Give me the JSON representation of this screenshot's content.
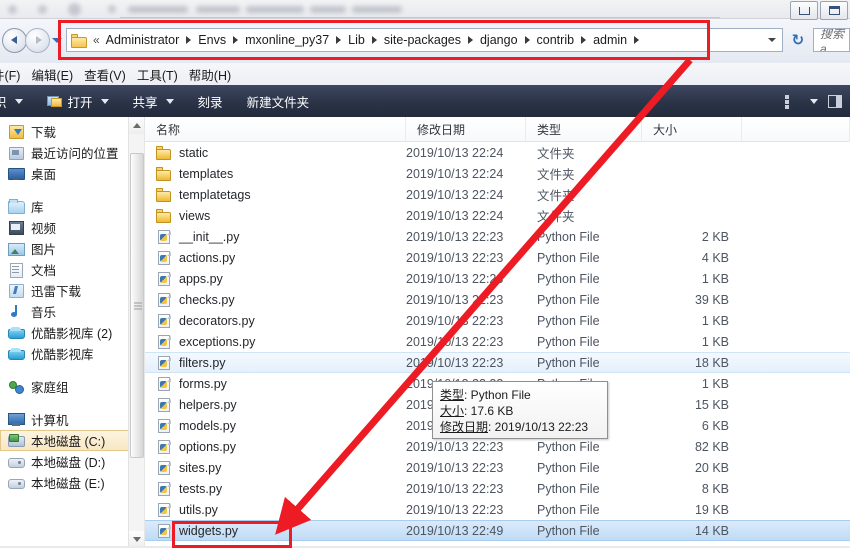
{
  "window": {
    "controls": [
      {
        "name": "minimize",
        "label": "–"
      },
      {
        "name": "maximize",
        "label": "□"
      }
    ]
  },
  "address": {
    "overflow_chevron": "«",
    "breadcrumbs": [
      "Administrator",
      "Envs",
      "mxonline_py37",
      "Lib",
      "site-packages",
      "django",
      "contrib",
      "admin"
    ],
    "refresh_label": "↻",
    "dropdown_label": "▾"
  },
  "search": {
    "placeholder": "搜索 a"
  },
  "menu": {
    "items": [
      "件(F)",
      "编辑(E)",
      "查看(V)",
      "工具(T)",
      "帮助(H)"
    ]
  },
  "toolbar": {
    "items": [
      {
        "label": "织",
        "caret": true,
        "icon": false
      },
      {
        "label": "打开",
        "caret": true,
        "icon": true
      },
      {
        "label": "共享",
        "caret": true,
        "icon": false
      },
      {
        "label": "刻录",
        "caret": false,
        "icon": false
      },
      {
        "label": "新建文件夹",
        "caret": false,
        "icon": false
      }
    ]
  },
  "sidebar": {
    "groups": [
      {
        "items": [
          {
            "label": "下载",
            "icon": "download-icon",
            "selected": false
          },
          {
            "label": "最近访问的位置",
            "icon": "recent-places-icon",
            "selected": false
          },
          {
            "label": "桌面",
            "icon": "desktop-icon",
            "selected": false
          }
        ]
      },
      {
        "items": [
          {
            "label": "库",
            "icon": "library-icon",
            "selected": false
          },
          {
            "label": "视频",
            "icon": "video-icon",
            "selected": false
          },
          {
            "label": "图片",
            "icon": "pictures-icon",
            "selected": false
          },
          {
            "label": "文档",
            "icon": "documents-icon",
            "selected": false
          },
          {
            "label": "迅雷下载",
            "icon": "thunder-download-icon",
            "selected": false
          },
          {
            "label": "音乐",
            "icon": "music-icon",
            "selected": false
          },
          {
            "label": "优酷影视库 (2)",
            "icon": "youku-library-icon",
            "selected": false
          },
          {
            "label": "优酷影视库",
            "icon": "youku-library-icon",
            "selected": false
          }
        ]
      },
      {
        "items": [
          {
            "label": "家庭组",
            "icon": "homegroup-icon",
            "selected": false
          }
        ]
      },
      {
        "items": [
          {
            "label": "计算机",
            "icon": "computer-icon",
            "selected": false
          },
          {
            "label": "本地磁盘 (C:)",
            "icon": "disk-c-icon",
            "selected": true
          },
          {
            "label": "本地磁盘 (D:)",
            "icon": "disk-icon",
            "selected": false
          },
          {
            "label": "本地磁盘 (E:)",
            "icon": "disk-icon",
            "selected": false
          }
        ]
      }
    ]
  },
  "filelist": {
    "columns": [
      "名称",
      "修改日期",
      "类型",
      "大小"
    ],
    "rows": [
      {
        "name": "static",
        "date": "2019/10/13 22:24",
        "type": "文件夹",
        "size": "",
        "icon": "folder-icon",
        "state": ""
      },
      {
        "name": "templates",
        "date": "2019/10/13 22:24",
        "type": "文件夹",
        "size": "",
        "icon": "folder-icon",
        "state": ""
      },
      {
        "name": "templatetags",
        "date": "2019/10/13 22:24",
        "type": "文件夹",
        "size": "",
        "icon": "folder-icon",
        "state": ""
      },
      {
        "name": "views",
        "date": "2019/10/13 22:24",
        "type": "文件夹",
        "size": "",
        "icon": "folder-icon",
        "state": ""
      },
      {
        "name": "__init__.py",
        "date": "2019/10/13 22:23",
        "type": "Python File",
        "size": "2 KB",
        "icon": "python-file-icon",
        "state": ""
      },
      {
        "name": "actions.py",
        "date": "2019/10/13 22:23",
        "type": "Python File",
        "size": "4 KB",
        "icon": "python-file-icon",
        "state": ""
      },
      {
        "name": "apps.py",
        "date": "2019/10/13 22:23",
        "type": "Python File",
        "size": "1 KB",
        "icon": "python-file-icon",
        "state": ""
      },
      {
        "name": "checks.py",
        "date": "2019/10/13 22:23",
        "type": "Python File",
        "size": "39 KB",
        "icon": "python-file-icon",
        "state": ""
      },
      {
        "name": "decorators.py",
        "date": "2019/10/13 22:23",
        "type": "Python File",
        "size": "1 KB",
        "icon": "python-file-icon",
        "state": ""
      },
      {
        "name": "exceptions.py",
        "date": "2019/10/13 22:23",
        "type": "Python File",
        "size": "1 KB",
        "icon": "python-file-icon",
        "state": ""
      },
      {
        "name": "filters.py",
        "date": "2019/10/13 22:23",
        "type": "Python File",
        "size": "18 KB",
        "icon": "python-file-icon",
        "state": "hover"
      },
      {
        "name": "forms.py",
        "date": "2019/10/13 22:23",
        "type": "Python File",
        "size": "1 KB",
        "icon": "python-file-icon",
        "state": ""
      },
      {
        "name": "helpers.py",
        "date": "2019/10/13 22:23",
        "type": "Python File",
        "size": "15 KB",
        "icon": "python-file-icon",
        "state": ""
      },
      {
        "name": "models.py",
        "date": "2019/10/13 22:23",
        "type": "Python File",
        "size": "6 KB",
        "icon": "python-file-icon",
        "state": ""
      },
      {
        "name": "options.py",
        "date": "2019/10/13 22:23",
        "type": "Python File",
        "size": "82 KB",
        "icon": "python-file-icon",
        "state": ""
      },
      {
        "name": "sites.py",
        "date": "2019/10/13 22:23",
        "type": "Python File",
        "size": "20 KB",
        "icon": "python-file-icon",
        "state": ""
      },
      {
        "name": "tests.py",
        "date": "2019/10/13 22:23",
        "type": "Python File",
        "size": "8 KB",
        "icon": "python-file-icon",
        "state": ""
      },
      {
        "name": "utils.py",
        "date": "2019/10/13 22:23",
        "type": "Python File",
        "size": "19 KB",
        "icon": "python-file-icon",
        "state": ""
      },
      {
        "name": "widgets.py",
        "date": "2019/10/13 22:49",
        "type": "Python File",
        "size": "14 KB",
        "icon": "python-file-icon",
        "state": "selected"
      }
    ]
  },
  "tooltip": {
    "type_line": "类型: Python File",
    "type_key": "类型",
    "type_value": ": Python File",
    "size_key": "大小",
    "size_value": ": 17.6 KB",
    "date_key": "修改日期",
    "date_value": ": 2019/10/13 22:23"
  },
  "annotations": {
    "color": "#ed1c24",
    "rect_address_label": "address-bar-highlight",
    "rect_widgets_label": "widgets-file-highlight",
    "arrow_label": "pointer-arrow"
  }
}
